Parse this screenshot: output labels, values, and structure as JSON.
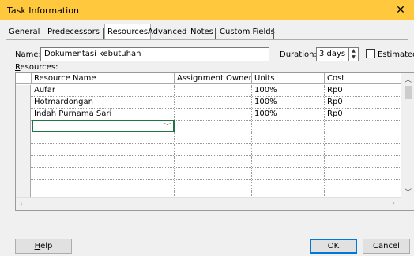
{
  "window": {
    "title": "Task Information",
    "close_glyph": "✕"
  },
  "tabs": [
    {
      "label": "General",
      "active": false
    },
    {
      "label": "Predecessors",
      "active": false
    },
    {
      "label": "Resources",
      "active": true
    },
    {
      "label": "Advanced",
      "active": false
    },
    {
      "label": "Notes",
      "active": false
    },
    {
      "label": "Custom Fields",
      "active": false
    }
  ],
  "form": {
    "name_label_key": "N",
    "name_label_rest": "ame:",
    "name_value": "Dokumentasi kebutuhan",
    "duration_label_key": "D",
    "duration_label_rest": "uration:",
    "duration_value": "3 days",
    "estimated_key": "E",
    "estimated_rest": "stimated",
    "estimated_checked": false,
    "resources_label_key": "R",
    "resources_label_rest": "esources:"
  },
  "grid": {
    "columns": [
      "Resource Name",
      "Assignment Owner",
      "Units",
      "Cost"
    ],
    "rows": [
      {
        "name": "Aufar",
        "owner": "",
        "units": "100%",
        "cost": "Rp0"
      },
      {
        "name": "Hotmardongan",
        "owner": "",
        "units": "100%",
        "cost": "Rp0"
      },
      {
        "name": "Indah Purnama Sari",
        "owner": "",
        "units": "100%",
        "cost": "Rp0"
      },
      {
        "name": "",
        "owner": "",
        "units": "",
        "cost": ""
      },
      {
        "name": "",
        "owner": "",
        "units": "",
        "cost": ""
      },
      {
        "name": "",
        "owner": "",
        "units": "",
        "cost": ""
      },
      {
        "name": "",
        "owner": "",
        "units": "",
        "cost": ""
      },
      {
        "name": "",
        "owner": "",
        "units": "",
        "cost": ""
      },
      {
        "name": "",
        "owner": "",
        "units": "",
        "cost": ""
      },
      {
        "name": "",
        "owner": "",
        "units": "",
        "cost": ""
      }
    ]
  },
  "buttons": {
    "help_key": "H",
    "help_rest": "elp",
    "ok": "OK",
    "cancel": "Cancel"
  },
  "colors": {
    "titlebar": "#ffc83d",
    "focus_border": "#217346",
    "default_button": "#0078d7"
  }
}
